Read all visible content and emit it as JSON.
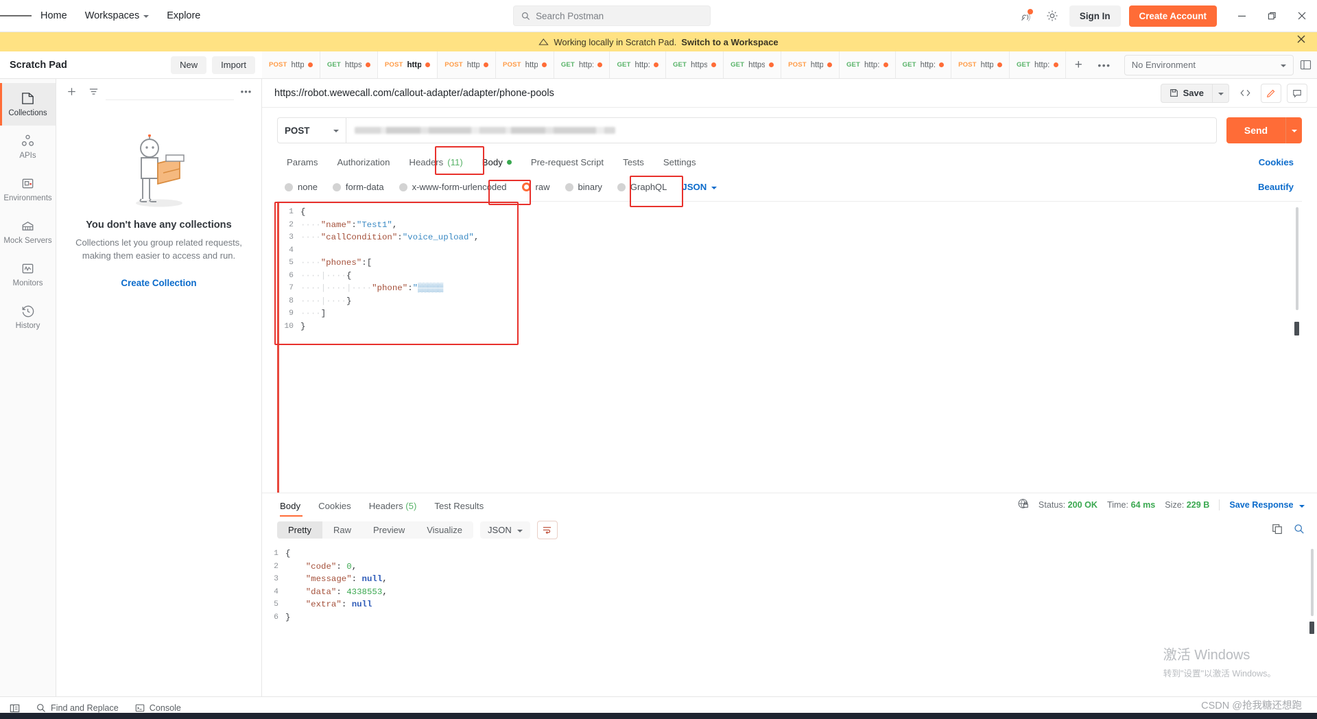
{
  "app": {
    "topnav": {
      "home": "Home",
      "workspaces": "Workspaces",
      "explore": "Explore"
    },
    "search": {
      "placeholder": "Search Postman",
      "icon": "search-icon"
    },
    "signin": "Sign In",
    "create_account": "Create Account",
    "accent": "#ff6c37"
  },
  "banner": {
    "text": "Working locally in Scratch Pad.",
    "link": "Switch to a Workspace",
    "bg": "#ffe283"
  },
  "pad": {
    "title": "Scratch Pad",
    "new": "New",
    "import": "Import"
  },
  "environment": {
    "selected": "No Environment"
  },
  "tabs": [
    {
      "method": "POST",
      "url": "http",
      "dirty": true,
      "active": false
    },
    {
      "method": "GET",
      "url": "https",
      "dirty": true,
      "active": false
    },
    {
      "method": "POST",
      "url": "http",
      "dirty": true,
      "active": true
    },
    {
      "method": "POST",
      "url": "http",
      "dirty": true,
      "active": false
    },
    {
      "method": "POST",
      "url": "http",
      "dirty": true,
      "active": false
    },
    {
      "method": "GET",
      "url": "http:",
      "dirty": true,
      "active": false
    },
    {
      "method": "GET",
      "url": "http:",
      "dirty": true,
      "active": false
    },
    {
      "method": "GET",
      "url": "https",
      "dirty": true,
      "active": false
    },
    {
      "method": "GET",
      "url": "https",
      "dirty": true,
      "active": false
    },
    {
      "method": "POST",
      "url": "http",
      "dirty": true,
      "active": false
    },
    {
      "method": "GET",
      "url": "http:",
      "dirty": true,
      "active": false
    },
    {
      "method": "GET",
      "url": "http:",
      "dirty": true,
      "active": false
    },
    {
      "method": "POST",
      "url": "http",
      "dirty": true,
      "active": false
    },
    {
      "method": "GET",
      "url": "http:",
      "dirty": true,
      "active": false
    }
  ],
  "sidebar": {
    "items": [
      {
        "label": "Collections",
        "icon": "collections-icon",
        "active": true
      },
      {
        "label": "APIs",
        "icon": "apis-icon",
        "active": false
      },
      {
        "label": "Environments",
        "icon": "environments-icon",
        "active": false
      },
      {
        "label": "Mock Servers",
        "icon": "mock-servers-icon",
        "active": false
      },
      {
        "label": "Monitors",
        "icon": "monitors-icon",
        "active": false
      },
      {
        "label": "History",
        "icon": "history-icon",
        "active": false
      }
    ]
  },
  "collections_panel": {
    "empty_title": "You don't have any collections",
    "empty_desc": "Collections let you group related requests, making them easier to access and run.",
    "create_link": "Create Collection"
  },
  "request": {
    "breadcrumb": "https://robot.wewecall.com/callout-adapter/adapter/phone-pools",
    "save_label": "Save",
    "method": "POST",
    "url_value": "",
    "url_redacted": true,
    "send_label": "Send",
    "tabs": [
      {
        "label": "Params",
        "active": false
      },
      {
        "label": "Authorization",
        "active": false
      },
      {
        "label": "Headers",
        "count": "(11)",
        "active": false
      },
      {
        "label": "Body",
        "active": true,
        "dot": true
      },
      {
        "label": "Pre-request Script",
        "active": false
      },
      {
        "label": "Tests",
        "active": false
      },
      {
        "label": "Settings",
        "active": false
      }
    ],
    "cookies_link": "Cookies",
    "beautify_link": "Beautify",
    "body_types": [
      {
        "label": "none",
        "selected": false
      },
      {
        "label": "form-data",
        "selected": false
      },
      {
        "label": "x-www-form-urlencoded",
        "selected": false
      },
      {
        "label": "raw",
        "selected": true
      },
      {
        "label": "binary",
        "selected": false
      },
      {
        "label": "GraphQL",
        "selected": false
      }
    ],
    "raw_format": "JSON",
    "body_lines": [
      {
        "n": "1",
        "html": "{"
      },
      {
        "n": "2",
        "html": "····\"name\":\"Test1\","
      },
      {
        "n": "3",
        "html": "····\"callCondition\":\"voice_upload\","
      },
      {
        "n": "4",
        "html": ""
      },
      {
        "n": "5",
        "html": "····\"phones\":["
      },
      {
        "n": "6",
        "html": "····|····{"
      },
      {
        "n": "7",
        "html": "····|····|····\"phone\":\"▒▒▒▒▒"
      },
      {
        "n": "8",
        "html": "····|····}"
      },
      {
        "n": "9",
        "html": "····]"
      },
      {
        "n": "10",
        "html": "}"
      }
    ]
  },
  "response": {
    "tabs": [
      {
        "label": "Body",
        "active": true
      },
      {
        "label": "Cookies",
        "active": false
      },
      {
        "label": "Headers",
        "count": "(5)",
        "active": false
      },
      {
        "label": "Test Results",
        "active": false
      }
    ],
    "status_label": "Status:",
    "status_value": "200 OK",
    "time_label": "Time:",
    "time_value": "64 ms",
    "size_label": "Size:",
    "size_value": "229 B",
    "save_response": "Save Response",
    "view_modes": [
      {
        "label": "Pretty",
        "active": true
      },
      {
        "label": "Raw",
        "active": false
      },
      {
        "label": "Preview",
        "active": false
      },
      {
        "label": "Visualize",
        "active": false
      }
    ],
    "format": "JSON",
    "body": {
      "code": "0",
      "message": "null",
      "data": "4338553",
      "extra": "null"
    },
    "lines": [
      "1",
      "2",
      "3",
      "4",
      "5",
      "6"
    ]
  },
  "footer": {
    "find_replace": "Find and Replace",
    "console": "Console"
  },
  "watermark": {
    "win_title": "激活 Windows",
    "win_sub": "转到\"设置\"以激活 Windows。",
    "csdn": "CSDN @抢我糖还想跑"
  }
}
